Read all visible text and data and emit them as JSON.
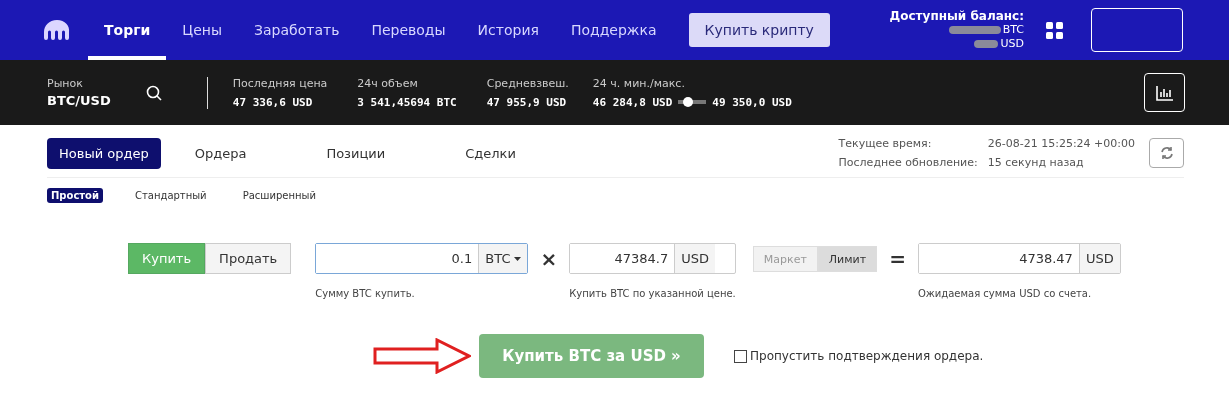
{
  "nav": {
    "items": [
      {
        "label": "Торги",
        "selected": true
      },
      {
        "label": "Цены",
        "selected": false
      },
      {
        "label": "Заработать",
        "selected": false
      },
      {
        "label": "Переводы",
        "selected": false
      },
      {
        "label": "История",
        "selected": false
      },
      {
        "label": "Поддержка",
        "selected": false
      }
    ],
    "buy_crypto": "Купить крипту",
    "balance": {
      "title": "Доступный баланс:",
      "lines": [
        "BTC",
        "USD"
      ]
    }
  },
  "market": {
    "label": "Рынок",
    "pair": "BTC/USD",
    "stats": [
      {
        "kind": "plain",
        "label": "Последняя цена",
        "value": "47 336,6 USD"
      },
      {
        "kind": "plain",
        "label": "24ч объем",
        "value": "3 541,45694 BTC"
      },
      {
        "kind": "plain",
        "label": "Средневзвеш.",
        "value": "47 955,9 USD"
      },
      {
        "kind": "range",
        "label": "24 ч. мин./макс.",
        "min": "46 284,8 USD",
        "max": "49 350,0 USD",
        "level": 0.25
      }
    ]
  },
  "tabs": [
    {
      "label": "Новый ордер",
      "selected": true
    },
    {
      "label": "Ордера",
      "selected": false
    },
    {
      "label": "Позиции",
      "selected": false
    },
    {
      "label": "Сделки",
      "selected": false
    }
  ],
  "info": [
    {
      "label": "Текущее время:",
      "value": "26-08-21 15:25:24 +00:00"
    },
    {
      "label": "Последнее обновление:",
      "value": "15 секунд назад"
    }
  ],
  "subtabs": [
    {
      "label": "Простой",
      "selected": true
    },
    {
      "label": "Стандартный",
      "selected": false
    },
    {
      "label": "Расширенный",
      "selected": false
    }
  ],
  "side": [
    {
      "label": "Купить",
      "selected": true
    },
    {
      "label": "Продать",
      "selected": false
    }
  ],
  "amount": {
    "value": "0.1",
    "unit": "BTC",
    "hint": "Сумму BTC купить."
  },
  "times": "×",
  "price": {
    "value": "47384.7",
    "unit": "USD",
    "hint": "Купить BTC по указанной цене."
  },
  "order_type": [
    {
      "label": "Маркет",
      "selected": false
    },
    {
      "label": "Лимит",
      "selected": true
    }
  ],
  "equals": "=",
  "total": {
    "value": "4738.47",
    "unit": "USD",
    "hint": "Ожидаемая сумма USD со счета."
  },
  "submit": "Купить BTC за USD »",
  "skip_confirm": {
    "label": "Пропустить подтверждения ордера.",
    "checked": false
  }
}
